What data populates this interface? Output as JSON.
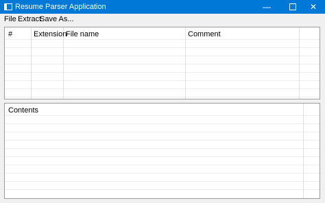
{
  "window": {
    "title": "Resume Parser Application"
  },
  "menu": {
    "file": "File",
    "extract": "Extract",
    "save_as": "Save As..."
  },
  "files_table": {
    "columns": [
      "#",
      "Extension",
      "File name",
      "Comment"
    ],
    "rows": []
  },
  "contents_panel": {
    "header": "Contents"
  },
  "icons": {
    "minimize": "minimize-icon",
    "maximize": "maximize-icon",
    "close": "close-icon"
  }
}
